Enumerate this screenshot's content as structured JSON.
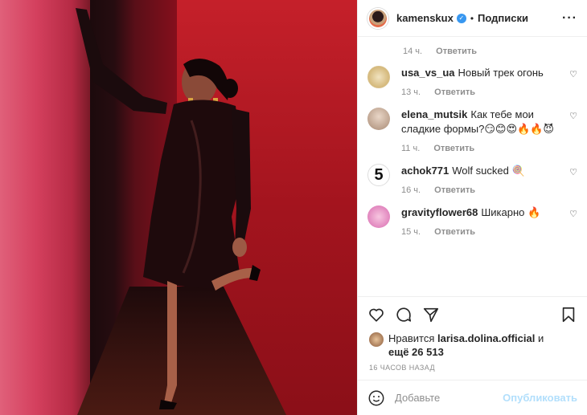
{
  "header": {
    "username": "kamenskux",
    "separator": "•",
    "follow_label": "Подписки",
    "more": "···"
  },
  "top_meta": {
    "time": "14 ч.",
    "reply": "Ответить"
  },
  "comments": [
    {
      "user": "usa_vs_ua",
      "text": "Новый трек огонь",
      "time": "13 ч.",
      "reply": "Ответить"
    },
    {
      "user": "elena_mutsik",
      "text": "Как тебе мои сладкие формы?😏😊😍🔥🔥😈",
      "time": "11 ч.",
      "reply": "Ответить"
    },
    {
      "user": "achok771",
      "text": "Wolf sucked 🍭",
      "time": "16 ч.",
      "reply": "Ответить"
    },
    {
      "user": "gravityflower68",
      "text": "Шикарно 🔥",
      "time": "15 ч.",
      "reply": "Ответить"
    }
  ],
  "likes": {
    "prefix": "Нравится ",
    "user": "larisa.dolina.official",
    "middle": " и",
    "count_text": "ещё 26 513"
  },
  "timestamp": "16 ЧАСОВ НАЗАД",
  "add_comment": {
    "placeholder": "Добавьте",
    "publish": "Опубликовать"
  },
  "icons": {
    "like": "heart-icon",
    "comment": "comment-icon",
    "share": "share-icon",
    "save": "bookmark-icon",
    "emoji": "smile-icon"
  }
}
